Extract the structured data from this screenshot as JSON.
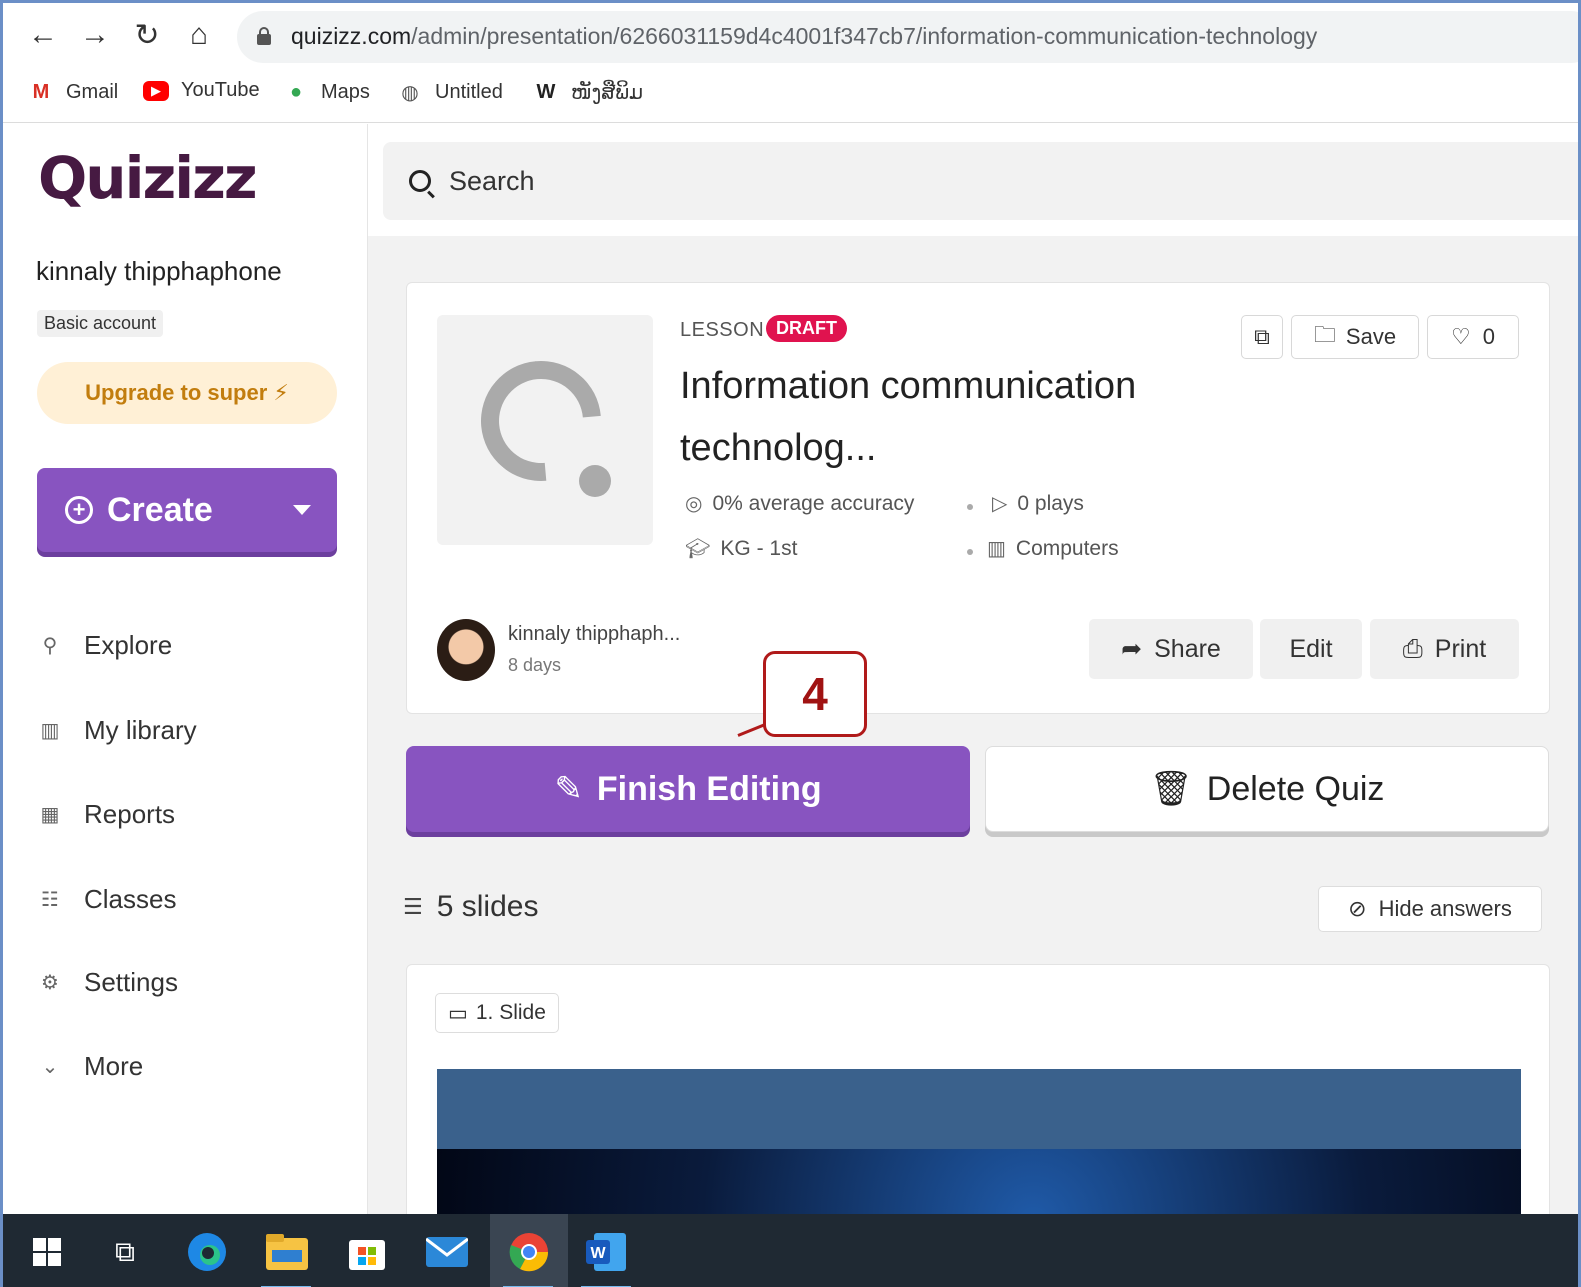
{
  "browser": {
    "url_host": "quizizz.com",
    "url_path": "/admin/presentation/6266031159d4c4001f347cb7/information-communication-technology",
    "bookmarks": [
      {
        "label": "Gmail",
        "icon": "gmail-icon",
        "glyph": "M",
        "color": "#d93025"
      },
      {
        "label": "YouTube",
        "icon": "youtube-icon",
        "glyph": "▶",
        "color": "#ff0000"
      },
      {
        "label": "Maps",
        "icon": "maps-pin-icon",
        "glyph": "●",
        "color": "#34a853"
      },
      {
        "label": "Untitled",
        "icon": "globe-icon",
        "glyph": "◍",
        "color": "#555555"
      },
      {
        "label": "ໜັງສືພິມ",
        "icon": "w-icon",
        "glyph": "W",
        "color": "#222222"
      }
    ]
  },
  "sidebar": {
    "logo": "Quizizz",
    "user_name": "kinnaly thipphaphone",
    "account_type": "Basic account",
    "upgrade_label": "Upgrade to super ⚡",
    "create_label": "Create",
    "nav": [
      {
        "label": "Explore",
        "icon": "explore-icon",
        "glyph": "⚲"
      },
      {
        "label": "My library",
        "icon": "library-icon",
        "glyph": "▥"
      },
      {
        "label": "Reports",
        "icon": "reports-icon",
        "glyph": "▦"
      },
      {
        "label": "Classes",
        "icon": "classes-icon",
        "glyph": "☷"
      },
      {
        "label": "Settings",
        "icon": "settings-icon",
        "glyph": "⚙"
      },
      {
        "label": "More",
        "icon": "chevron-down-icon",
        "glyph": "⌄"
      }
    ]
  },
  "main": {
    "search_label": "Search",
    "quiz": {
      "type": "LESSON",
      "status": "DRAFT",
      "title": "Information communication technolog...",
      "accuracy": "0% average accuracy",
      "plays": "0 plays",
      "grade": "KG - 1st",
      "subject": "Computers",
      "save_label": "Save",
      "likes": "0",
      "author": "kinnaly thipphaph...",
      "time": "8 days",
      "share_label": "Share",
      "edit_label": "Edit",
      "print_label": "Print"
    },
    "finish_label": "Finish Editing",
    "delete_label": "Delete Quiz",
    "callout_number": "4",
    "slides_count": "5 slides",
    "hide_answers_label": "Hide answers",
    "slide_tag": "1. Slide"
  },
  "colors": {
    "brand_purple": "#8854c0",
    "draft_red": "#e0134f",
    "logo": "#461a42",
    "upgrade_bg": "#fff0d6",
    "callout": "#b01a1a"
  }
}
